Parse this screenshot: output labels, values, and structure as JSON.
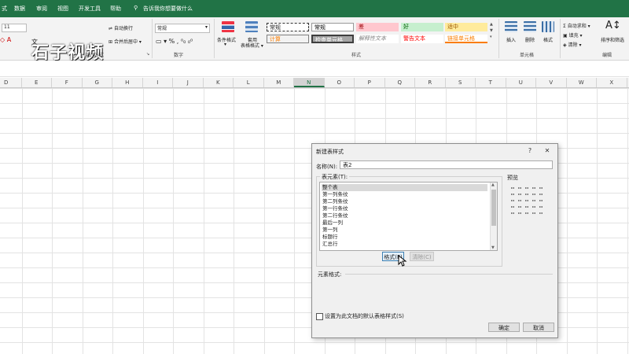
{
  "tabs": [
    "式",
    "数据",
    "审阅",
    "视图",
    "开发工具",
    "帮助"
  ],
  "tell_me": "告诉我你想要做什么",
  "watermark": "石子视频",
  "ribbon": {
    "font_size": "11",
    "wrap_text": "自动换行",
    "merge_center": "合并后居中",
    "alignment_label": "对齐方式",
    "number_format": "常规",
    "number_label": "数字",
    "conditional_format": "条件格式",
    "format_as_table": [
      "套用",
      "表格格式"
    ],
    "styles_label": "样式",
    "style_cells": [
      {
        "label": "常规",
        "bg": "#ffffff",
        "fg": "#000000"
      },
      {
        "label": "差",
        "bg": "#ffc7ce",
        "fg": "#9c0006"
      },
      {
        "label": "好",
        "bg": "#c6efce",
        "fg": "#006100"
      },
      {
        "label": "适中",
        "bg": "#ffeb9c",
        "fg": "#9c5700"
      },
      {
        "label": "计算",
        "bg": "#f2f2f2",
        "fg": "#fa7d00"
      },
      {
        "label": "检查单元格",
        "bg": "#a5a5a5",
        "fg": "#ffffff"
      },
      {
        "label": "解释性文本",
        "bg": "#ffffff",
        "fg": "#7f7f7f"
      },
      {
        "label": "警告文本",
        "bg": "#ffffff",
        "fg": "#ff0000"
      },
      {
        "label": "链接单元格",
        "bg": "#ffffff",
        "fg": "#fa7d00"
      }
    ],
    "insert": "插入",
    "delete": "删除",
    "format": "格式",
    "cells_label": "单元格",
    "autosum": "自动求和",
    "fill": "填充",
    "clear": "清除",
    "sort_filter": "排序和筛选",
    "editing_label": "编辑"
  },
  "columns": [
    "D",
    "E",
    "F",
    "G",
    "H",
    "I",
    "J",
    "K",
    "L",
    "M",
    "N",
    "O",
    "P",
    "Q",
    "R",
    "S",
    "T",
    "U",
    "V",
    "W",
    "X"
  ],
  "selected_column": "N",
  "dialog": {
    "title": "新建表样式",
    "help": "?",
    "close": "✕",
    "name_label": "名称(N):",
    "name_value": "表2",
    "element_label": "表元素(T):",
    "elements": [
      "整个表",
      "第一列条纹",
      "第二列条纹",
      "第一行条纹",
      "第二行条纹",
      "最后一列",
      "第一列",
      "标题行",
      "汇总行"
    ],
    "selected_element": "整个表",
    "format_button": "格式(F)",
    "clear_button": "清除(C)",
    "preview_label": "预览",
    "element_format_label": "元素格式:",
    "default_checkbox": "设置为此文档的默认表格样式(S)",
    "ok": "确定",
    "cancel": "取消"
  }
}
